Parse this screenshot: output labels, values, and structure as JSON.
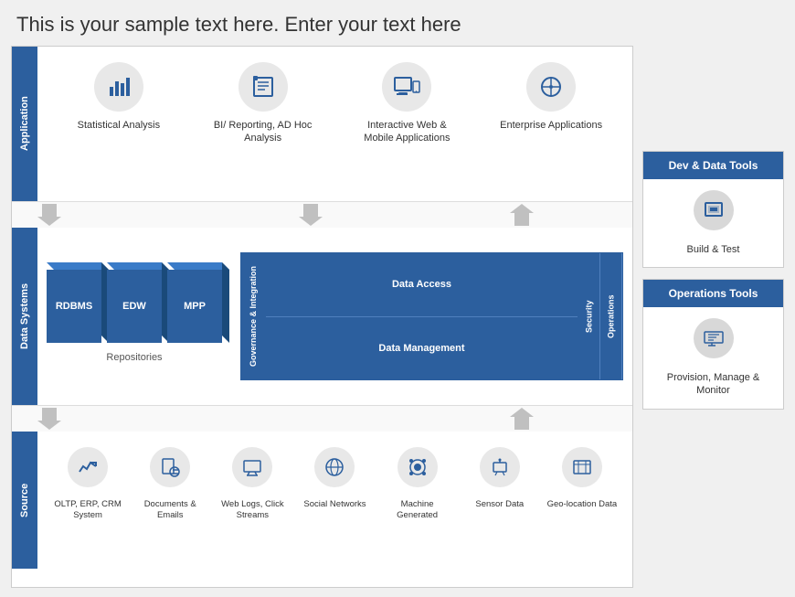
{
  "header": {
    "text": "This is your sample text here. Enter your text here"
  },
  "diagram": {
    "layers": {
      "application": "Application",
      "dataSystems": "Data Systems",
      "source": "Source"
    },
    "appIcons": [
      {
        "label": "Statistical Analysis",
        "icon": "📊"
      },
      {
        "label": "BI/ Reporting, AD Hoc Analysis",
        "icon": "📋"
      },
      {
        "label": "Interactive Web & Mobile Applications",
        "icon": "🖥"
      },
      {
        "label": "Enterprise Applications",
        "icon": "✳"
      }
    ],
    "repositories": {
      "label": "Repositories",
      "items": [
        "RDBMS",
        "EDW",
        "MPP"
      ]
    },
    "dataPlatform": {
      "governance": "Governance & Integration",
      "dataAccess": "Data Access",
      "dataManagement": "Data Management",
      "security": "Security",
      "operations": "Operations"
    },
    "sourceIcons": [
      {
        "label": "OLTP, ERP, CRM System",
        "icon": "📈"
      },
      {
        "label": "Documents & Emails",
        "icon": "📧"
      },
      {
        "label": "Web Logs, Click Streams",
        "icon": "🖥"
      },
      {
        "label": "Social Networks",
        "icon": "🌐"
      },
      {
        "label": "Machine Generated",
        "icon": "⚙"
      },
      {
        "label": "Sensor Data",
        "icon": "📽"
      },
      {
        "label": "Geo-location Data",
        "icon": "📋"
      }
    ]
  },
  "sidebar": {
    "devTools": {
      "header": "Dev & Data Tools",
      "icon": "🖥",
      "label": "Build & Test"
    },
    "opsTools": {
      "header": "Operations Tools",
      "icon": "🖥",
      "label": "Provision, Manage & Monitor"
    }
  }
}
